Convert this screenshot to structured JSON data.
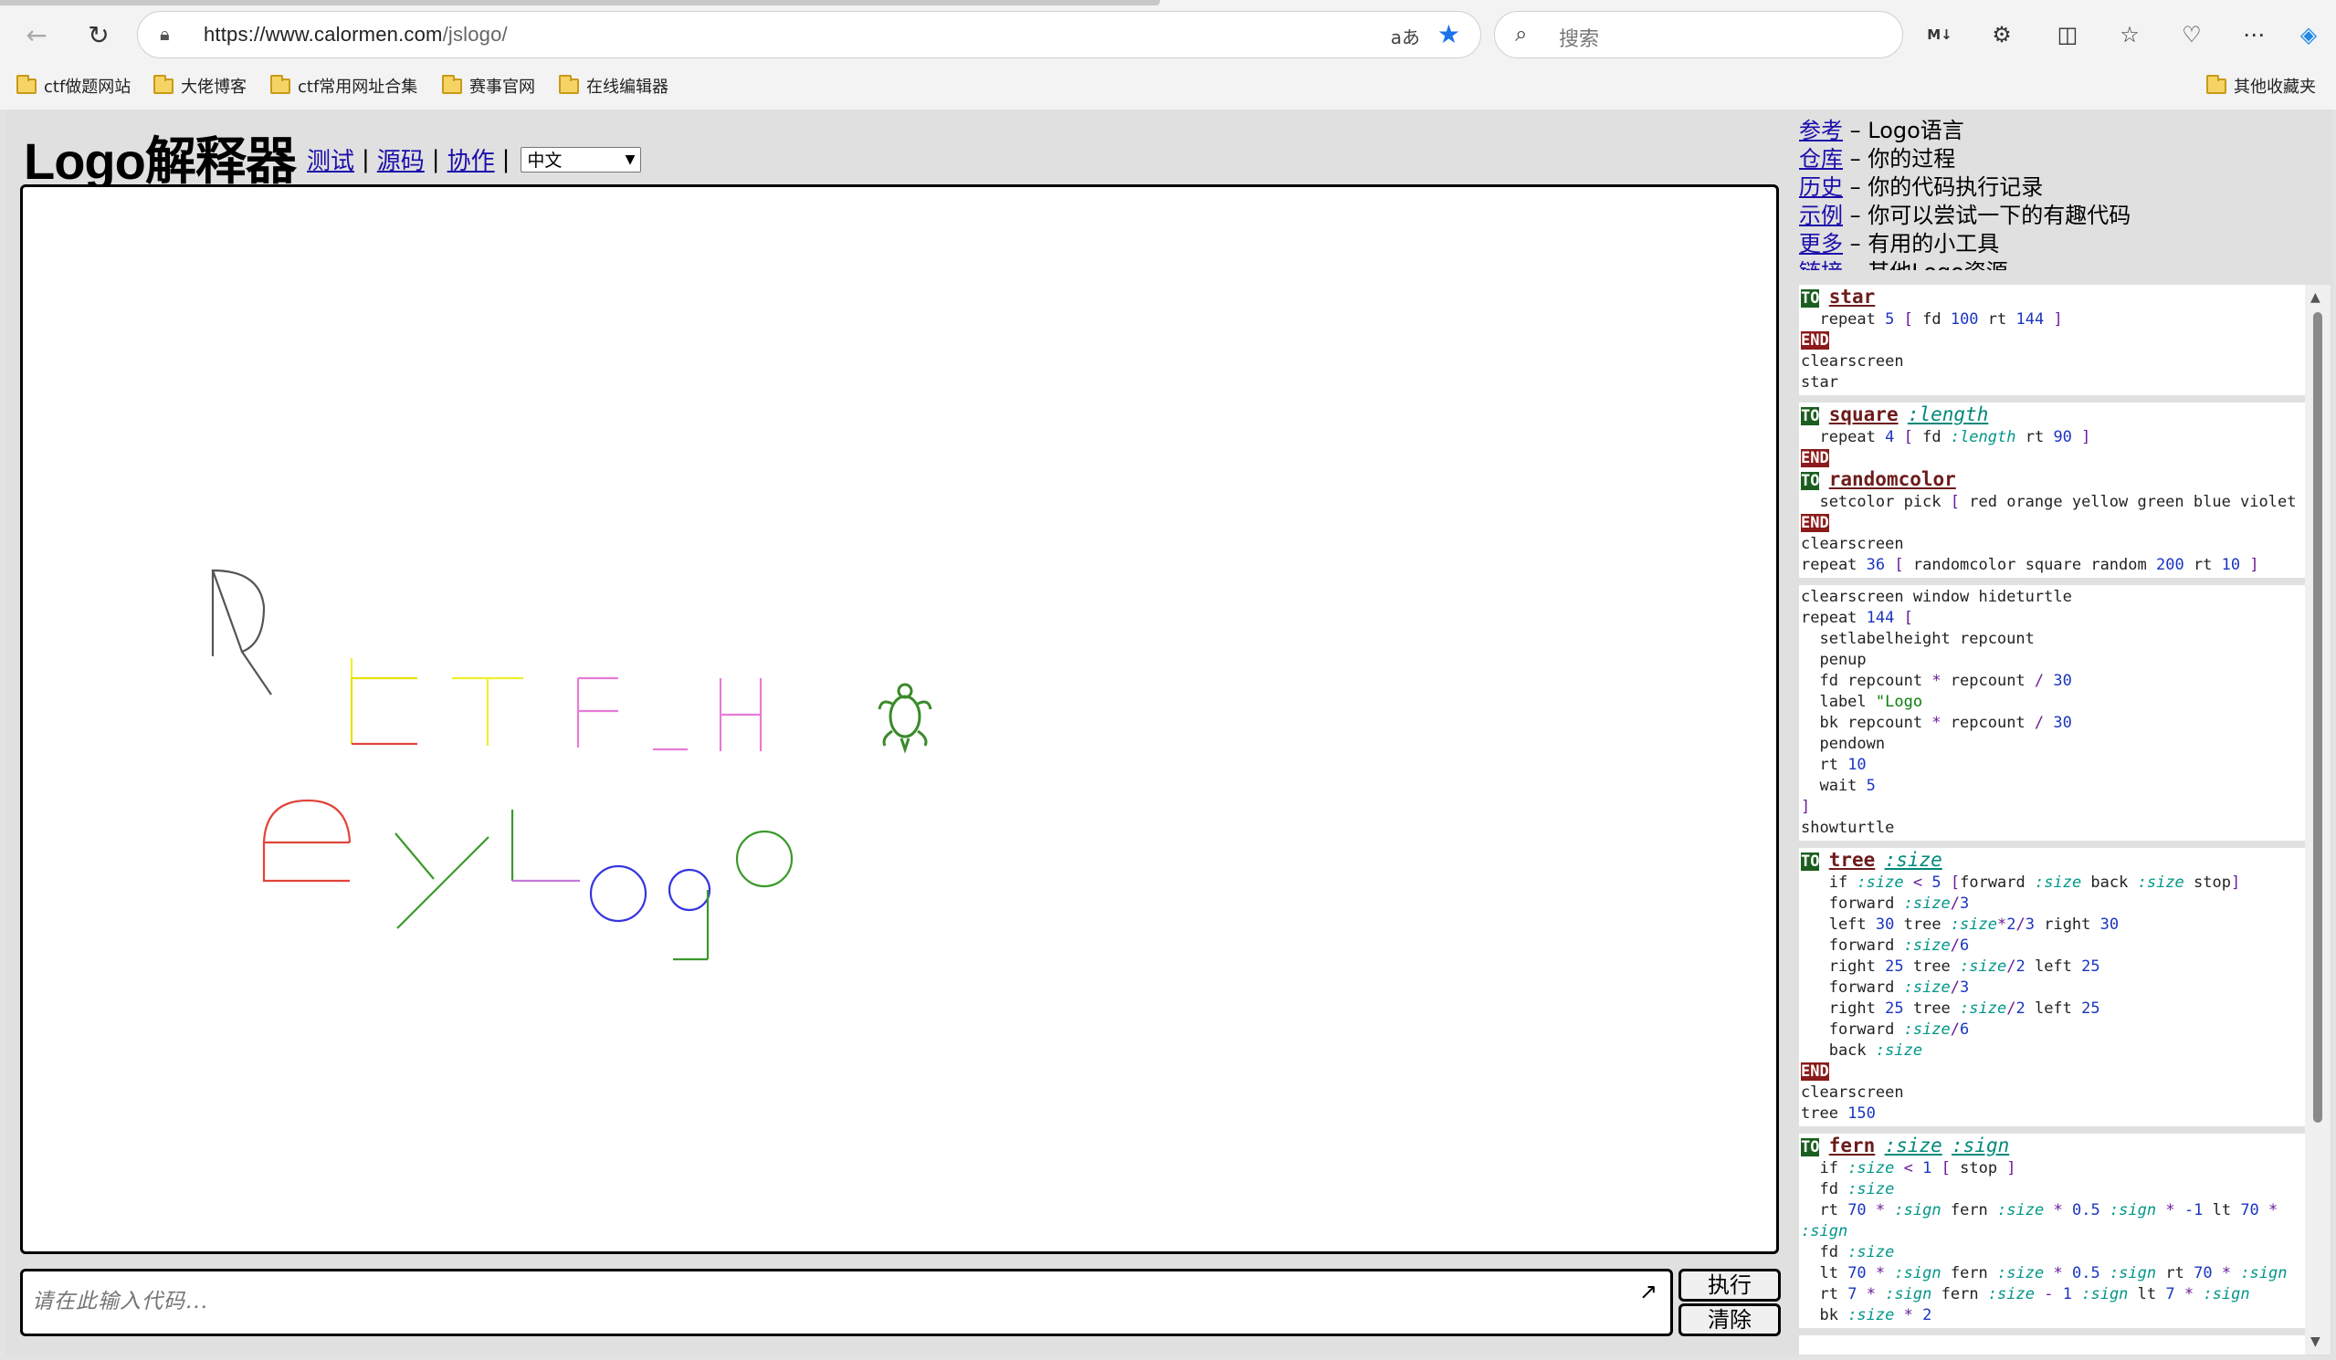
{
  "browser": {
    "url_host": "https://www.calormen.com",
    "url_path": "/jslogo/",
    "search_placeholder": "搜索",
    "bookmarks": [
      "ctf做题网站",
      "大佬博客",
      "ctf常用网址合集",
      "赛事官网",
      "在线编辑器"
    ],
    "other_bookmarks": "其他收藏夹",
    "accent_color": "#1a73e8"
  },
  "header": {
    "title": "Logo解释器",
    "links": [
      "测试",
      "源码",
      "协作"
    ],
    "separator": "|",
    "language": "中文"
  },
  "canvas": {
    "turtle_color": "#3a8a2a"
  },
  "input": {
    "placeholder": "请在此输入代码...",
    "run_label": "执行",
    "clear_label": "清除"
  },
  "refs": [
    {
      "link": "参考",
      "desc": " – Logo语言"
    },
    {
      "link": "仓库",
      "desc": " – 你的过程"
    },
    {
      "link": "历史",
      "desc": " – 你的代码执行记录"
    },
    {
      "link": "示例",
      "desc": " – 你可以尝试一下的有趣代码"
    },
    {
      "link": "更多",
      "desc": " – 有用的小工具"
    },
    {
      "link": "链接",
      "desc": " – 其他Logo资源"
    }
  ]
}
